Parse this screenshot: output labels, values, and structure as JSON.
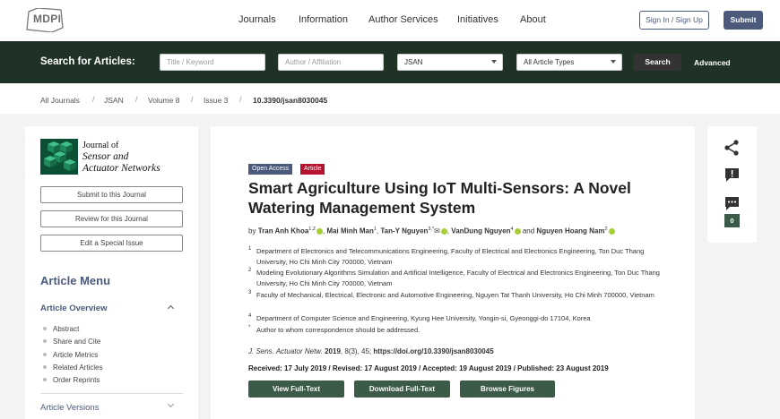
{
  "header": {
    "logo_text": "MDPI",
    "nav": [
      "Journals",
      "Information",
      "Author Services",
      "Initiatives",
      "About"
    ],
    "signin_label": "Sign In / Sign Up",
    "submit_label": "Submit"
  },
  "search": {
    "label": "Search for Articles:",
    "title_placeholder": "Title / Keyword",
    "author_placeholder": "Author / Affiliation",
    "journal_value": "JSAN",
    "type_value": "All Article Types",
    "search_button": "Search",
    "advanced_link": "Advanced"
  },
  "breadcrumb": [
    "All Journals",
    "JSAN",
    "Volume 8",
    "Issue 3",
    "10.3390/jsan8030045"
  ],
  "left": {
    "journal_title_1": "Journal of",
    "journal_title_2": "Sensor and",
    "journal_title_3": "Actuator Networks",
    "buttons": [
      "Submit to this Journal",
      "Review for this Journal",
      "Edit a Special Issue"
    ],
    "menu_title": "Article Menu",
    "overview_title": "Article Overview",
    "menu_items": [
      "Abstract",
      "Share and Cite",
      "Article Metrics",
      "Related Articles",
      "Order Reprints"
    ],
    "versions": "Article Versions"
  },
  "article": {
    "badge_open": "Open Access",
    "badge_type": "Article",
    "title": "Smart Agriculture Using IoT Multi-Sensors: A Novel Watering Management System",
    "by": "by",
    "authors": [
      {
        "name": "Tran Anh Khoa",
        "sup": "1,2"
      },
      {
        "name": "Mai Minh Man",
        "sup": "1"
      },
      {
        "name": "Tan-Y Nguyen",
        "sup": "3,*"
      },
      {
        "name": "VanDung Nguyen",
        "sup": "4"
      },
      {
        "name": "Nguyen Hoang Nam",
        "sup": "2"
      }
    ],
    "and": "and",
    "affiliations": [
      {
        "num": "1",
        "text": "Department of Electronics and Telecommunications Engineering, Faculty of Electrical and Electronics Engineering, Ton Duc Thang University, Ho Chi Minh City 700000, Vietnam"
      },
      {
        "num": "2",
        "text": "Modeling Evolutionary Algorithms Simulation and Artificial Intelligence, Faculty of Electrical and Electronics Engineering, Ton Duc Thang University, Ho Chi Minh City 700000, Vietnam"
      },
      {
        "num": "3",
        "text": "Faculty of Mechanical, Electrical, Electronic and Automotive Engineering, Nguyen Tat Thanh University, Ho Chi Minh 700000, Vietnam"
      },
      {
        "num": "4",
        "text": "Department of Computer Science and Engineering, Kyung Hee University, Yongin-si, Gyeonggi-do 17104, Korea"
      },
      {
        "num": "*",
        "text": "Author to whom correspondence should be addressed."
      }
    ],
    "citation_journal": "J. Sens. Actuator Netw.",
    "citation_year": "2019",
    "citation_rest": ", 8(3), 45;",
    "citation_doi": "https://doi.org/10.3390/jsan8030045",
    "dates": "Received: 17 July 2019 / Revised: 17 August 2019 / Accepted: 19 August 2019 / Published: 23 August 2019",
    "buttons": [
      "View Full-Text",
      "Download Full-Text",
      "Browse Figures"
    ]
  },
  "right": {
    "comment_count": "0"
  },
  "colors": {
    "nav_accent": "#4b5a7a",
    "search_bg": "#1e3226",
    "action_green": "#3c5a48",
    "article_badge": "#b5122f",
    "orcid": "#a6ce39"
  }
}
